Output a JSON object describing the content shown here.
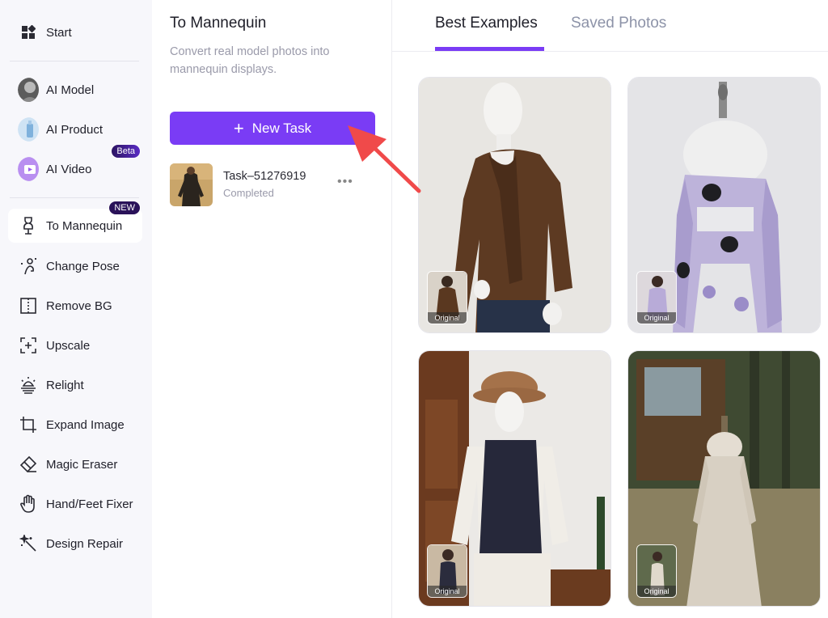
{
  "sidebar": {
    "items": [
      {
        "label": "Start",
        "icon": "grid-icon"
      },
      {
        "label": "AI Model",
        "icon": "ai-model-avatar"
      },
      {
        "label": "AI Product",
        "icon": "ai-product-avatar"
      },
      {
        "label": "AI Video",
        "icon": "ai-video-avatar",
        "badge": "Beta"
      },
      {
        "label": "To Mannequin",
        "icon": "mannequin-icon",
        "badge": "NEW",
        "active": true
      },
      {
        "label": "Change Pose",
        "icon": "change-pose-icon"
      },
      {
        "label": "Remove BG",
        "icon": "remove-bg-icon"
      },
      {
        "label": "Upscale",
        "icon": "upscale-icon"
      },
      {
        "label": "Relight",
        "icon": "relight-icon"
      },
      {
        "label": "Expand Image",
        "icon": "crop-expand-icon"
      },
      {
        "label": "Magic Eraser",
        "icon": "eraser-icon"
      },
      {
        "label": "Hand/Feet Fixer",
        "icon": "hand-icon"
      },
      {
        "label": "Design Repair",
        "icon": "magic-wand-icon"
      }
    ]
  },
  "panel": {
    "title": "To Mannequin",
    "description": "Convert real model photos into mannequin displays.",
    "new_task_label": "New Task",
    "tasks": [
      {
        "name": "Task–51276919",
        "status": "Completed"
      }
    ]
  },
  "main": {
    "tabs": [
      {
        "label": "Best Examples",
        "active": true
      },
      {
        "label": "Saved Photos",
        "active": false
      }
    ],
    "examples": [
      {
        "original_label": "Original"
      },
      {
        "original_label": "Original"
      },
      {
        "original_label": "Original"
      },
      {
        "original_label": "Original"
      }
    ]
  },
  "colors": {
    "accent": "#7a3cf5",
    "arrow": "#f04a4a",
    "sidebar_bg": "#f7f7fb"
  }
}
